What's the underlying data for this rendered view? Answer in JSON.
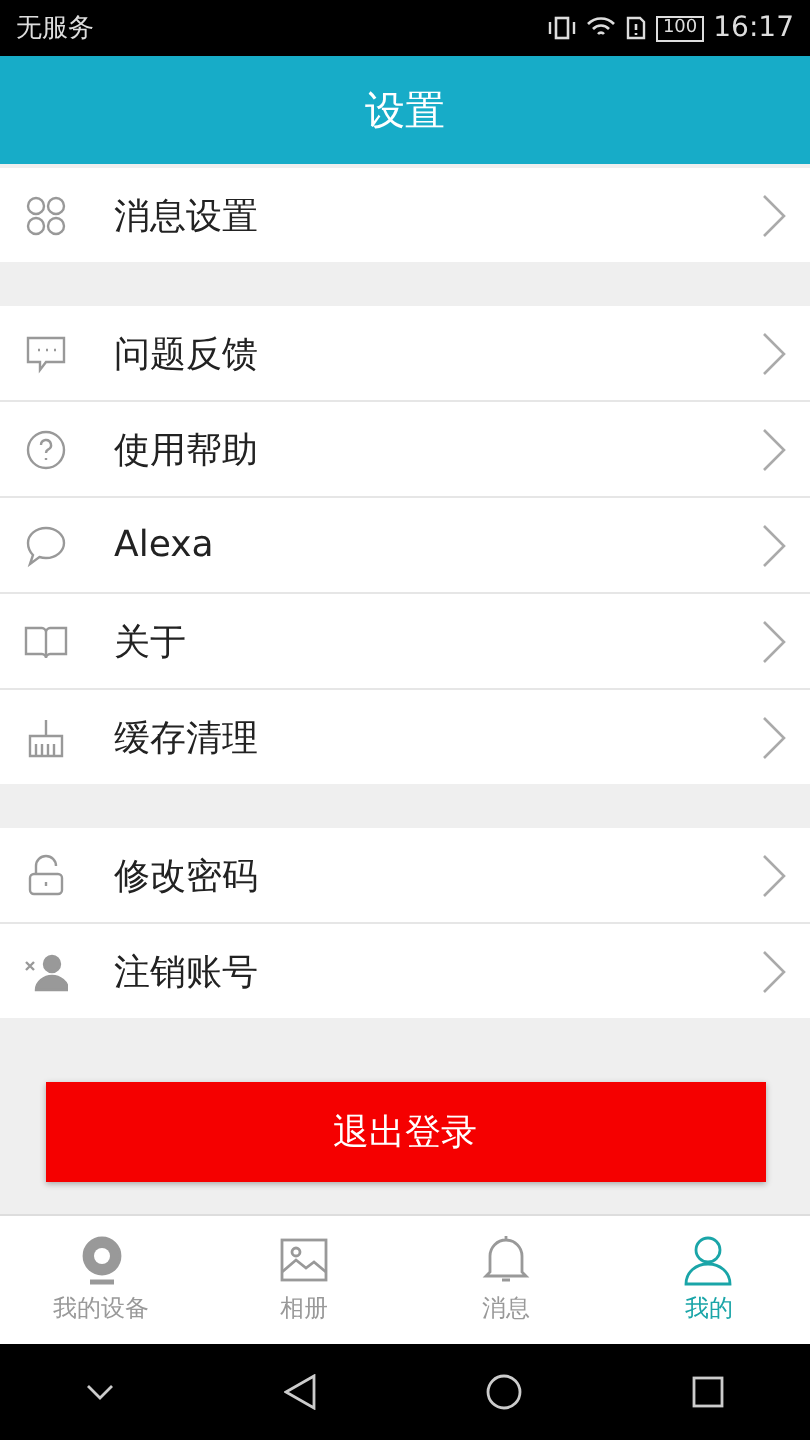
{
  "status_bar": {
    "carrier": "无服务",
    "battery": "100",
    "time": "16:17"
  },
  "header": {
    "title": "设置"
  },
  "groups": [
    {
      "items": [
        {
          "kind": "grid",
          "label": "消息设置"
        }
      ]
    },
    {
      "items": [
        {
          "kind": "chat",
          "label": "问题反馈"
        },
        {
          "kind": "help",
          "label": "使用帮助"
        },
        {
          "kind": "bubble",
          "label": "Alexa"
        },
        {
          "kind": "book",
          "label": "关于"
        },
        {
          "kind": "broom",
          "label": "缓存清理"
        }
      ]
    },
    {
      "items": [
        {
          "kind": "lock",
          "label": "修改密码"
        },
        {
          "kind": "userx",
          "label": "注销账号"
        }
      ]
    }
  ],
  "logout_button": "退出登录",
  "tabs": [
    {
      "kind": "camera",
      "label": "我的设备",
      "selected": false
    },
    {
      "kind": "image",
      "label": "相册",
      "selected": false
    },
    {
      "kind": "bell",
      "label": "消息",
      "selected": false
    },
    {
      "kind": "person",
      "label": "我的",
      "selected": true
    }
  ]
}
